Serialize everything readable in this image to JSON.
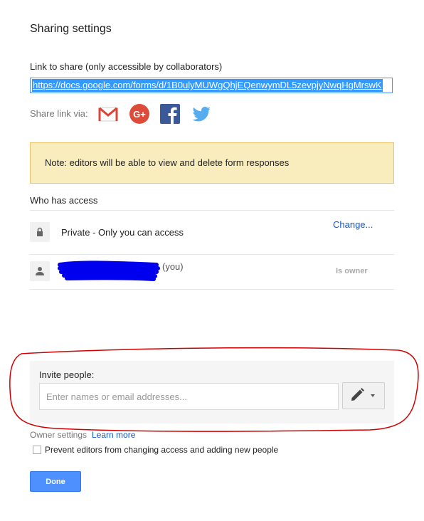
{
  "dialog": {
    "title": "Sharing settings",
    "link_label": "Link to share (only accessible by collaborators)",
    "link_value": "https://docs.google.com/forms/d/1B0ulyMUWgQhjEQenwymDL5zevpjyNwqHgMrswK",
    "share_via_label": "Share link via:",
    "share_icons": [
      "gmail-icon",
      "google-plus-icon",
      "facebook-icon",
      "twitter-icon"
    ],
    "note": "Note: editors will be able to view and delete form responses",
    "who_has_access": "Who has access",
    "access_rows": [
      {
        "icon": "lock-icon",
        "label": "Private - Only you can access",
        "action": "Change..."
      },
      {
        "icon": "person-icon",
        "name_suffix": "(you)",
        "role": "Is owner"
      }
    ],
    "invite": {
      "label": "Invite people:",
      "placeholder": "Enter names or email addresses...",
      "permission_icon": "pencil-icon"
    },
    "owner_settings": {
      "label": "Owner settings",
      "learn_more": "Learn more",
      "checkbox_label": "Prevent editors from changing access and adding new people",
      "checked": false
    },
    "done_label": "Done"
  },
  "colors": {
    "accent": "#4d90fe",
    "link": "#1155cc",
    "note_bg": "#f9edbe",
    "annotation": "#d00000",
    "redaction": "#0000ee"
  }
}
